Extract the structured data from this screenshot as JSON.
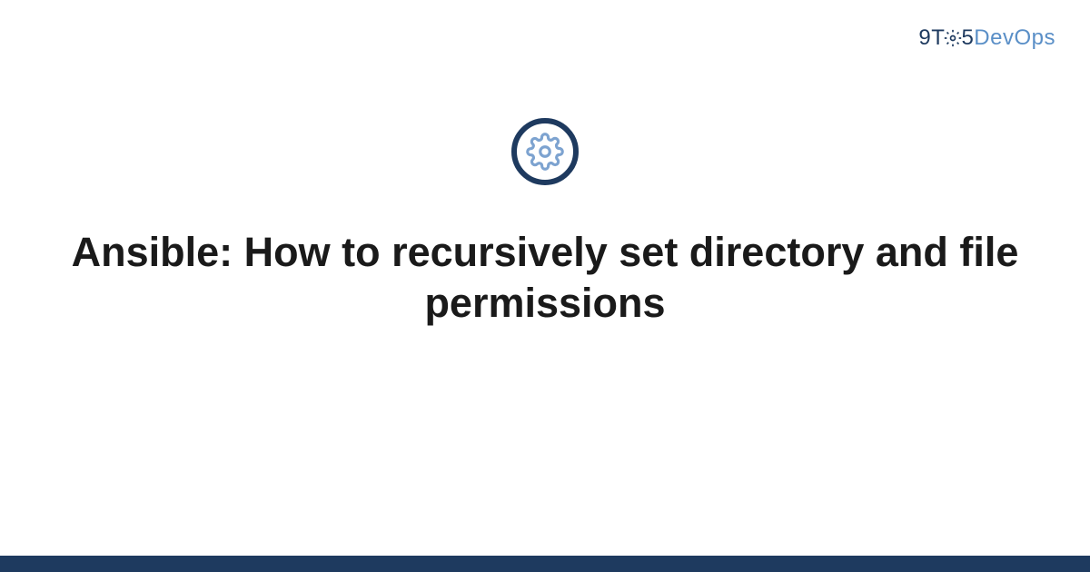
{
  "brand": {
    "nine": "9",
    "t": "T",
    "five": "5",
    "devops": "DevOps"
  },
  "title": "Ansible: How to recursively set directory and file permissions",
  "colors": {
    "primary": "#1e3a5f",
    "accent": "#5a8fc7",
    "icon_fill": "#7da3d0"
  }
}
